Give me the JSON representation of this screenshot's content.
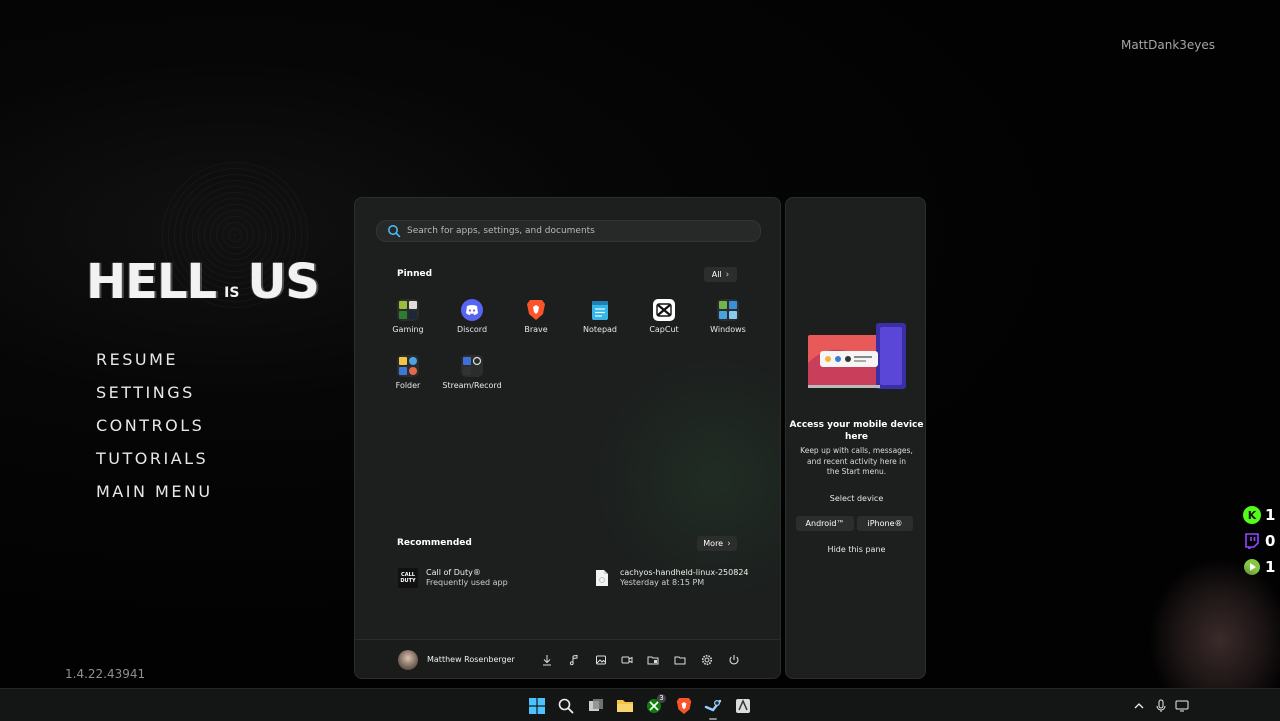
{
  "game": {
    "logo": {
      "word1": "HELL",
      "word2": "IS",
      "word3": "US"
    },
    "menu": [
      "RESUME",
      "SETTINGS",
      "CONTROLS",
      "TUTORIALS",
      "MAIN MENU"
    ],
    "version": "1.4.22.43941"
  },
  "overlay": {
    "streamer_name": "MattDank3eyes",
    "stats": [
      {
        "icon": "kick-icon",
        "value": "1",
        "color": "#53fc18"
      },
      {
        "icon": "twitch-icon",
        "value": "0",
        "color": "#9146ff"
      },
      {
        "icon": "rumble-icon",
        "value": "1",
        "color": "#85c742"
      }
    ]
  },
  "start_menu": {
    "search": {
      "placeholder": "Search for apps, settings, and documents"
    },
    "pinned": {
      "title": "Pinned",
      "all_label": "All",
      "apps": [
        {
          "label": "Gaming",
          "icon": "gaming-folder-icon"
        },
        {
          "label": "Discord",
          "icon": "discord-icon",
          "color": "#5865f2"
        },
        {
          "label": "Brave",
          "icon": "brave-icon",
          "color": "#fb542b"
        },
        {
          "label": "Notepad",
          "icon": "notepad-icon",
          "color": "#36b6e8"
        },
        {
          "label": "CapCut",
          "icon": "capcut-icon",
          "color": "#ffffff"
        },
        {
          "label": "Windows",
          "icon": "windows-folder-icon"
        },
        {
          "label": "Folder",
          "icon": "folder-group-icon"
        },
        {
          "label": "Stream/Record",
          "icon": "stream-record-icon"
        }
      ]
    },
    "recommended": {
      "title": "Recommended",
      "more_label": "More",
      "items": [
        {
          "title": "Call of Duty®",
          "subtitle": "Frequently used app",
          "icon": "call-of-duty-icon",
          "icon_text": "CALL DUTY"
        },
        {
          "title": "cachyos-handheld-linux-250824",
          "subtitle": "Yesterday at 8:15 PM",
          "icon": "file-icon"
        }
      ]
    },
    "footer": {
      "user_name": "Matthew Rosenberger",
      "icons": [
        "downloads-icon",
        "music-icon",
        "pictures-icon",
        "videos-icon",
        "network-folder-icon",
        "file-explorer-icon",
        "settings-icon",
        "power-icon"
      ]
    }
  },
  "phone_pane": {
    "title": "Access your mobile device here",
    "description": "Keep up with calls, messages, and recent activity here in the Start menu.",
    "select_label": "Select device",
    "android_label": "Android™",
    "iphone_label": "iPhone®",
    "hide_label": "Hide this pane"
  },
  "taskbar": {
    "icons": [
      "windows-start-icon",
      "search-icon",
      "task-view-icon",
      "file-explorer-icon",
      "xbox-icon",
      "brave-icon",
      "steam-icon",
      "app-icon"
    ],
    "xbox_badge": "3",
    "tray": [
      "chevron-up-icon",
      "microphone-icon",
      "display-icon"
    ]
  },
  "colors": {
    "start_bg": "#1c1f1e",
    "accent": "#4cc2ff",
    "taskbar_bg": "#141615"
  }
}
